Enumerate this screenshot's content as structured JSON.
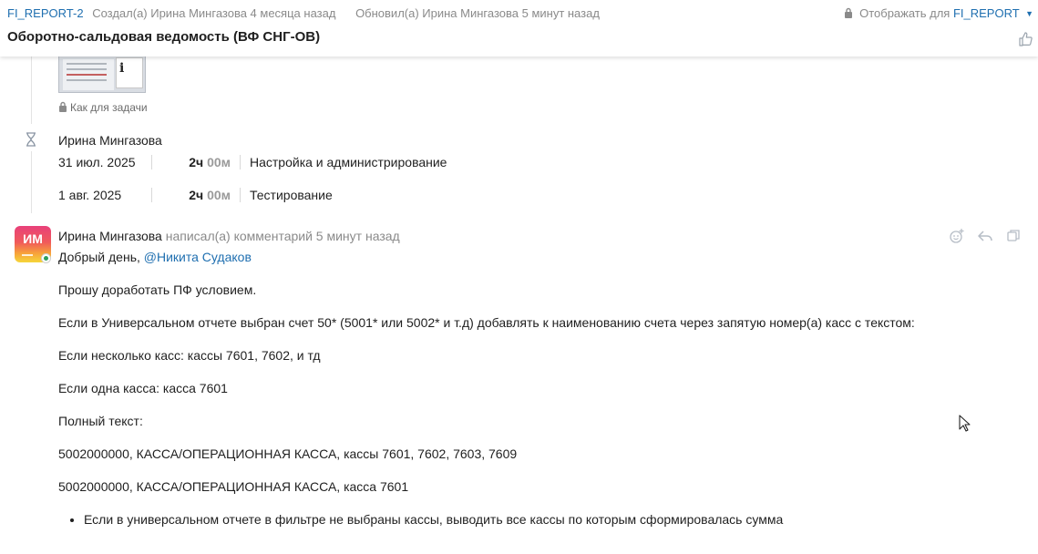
{
  "header": {
    "issue_key": "FI_REPORT-2",
    "created_text": "Создал(а) Ирина Мингазова 4 месяца назад",
    "updated_text": "Обновил(а) Ирина Мингазова 5 минут назад",
    "visibility_label": "Отображать для",
    "visibility_project": "FI_REPORT",
    "title": "Оборотно-сальдовая ведомость (ВФ СНГ-ОВ)"
  },
  "attachment": {
    "visibility_note": "Как для задачи"
  },
  "worklog": {
    "author": "Ирина Мингазова",
    "entries": [
      {
        "date": "31 июл. 2025",
        "hours": "2ч",
        "minutes": "00м",
        "activity": "Настройка и администрирование"
      },
      {
        "date": "1 авг. 2025",
        "hours": "2ч",
        "minutes": "00м",
        "activity": "Тестирование"
      }
    ]
  },
  "comment": {
    "avatar_initials": "ИМ",
    "author": "Ирина Мингазова",
    "action_text": "написал(а) комментарий 5 минут назад",
    "greeting": "Добрый день,",
    "mention": "@Никита Судаков",
    "paragraphs": [
      "Прошу доработать ПФ условием.",
      "Если в Универсальном отчете выбран счет 50* (5001* или 5002* и т.д) добавлять к наименованию счета через запятую номер(а) касс с текстом:",
      "Если несколько касс: кассы 7601, 7602, и тд",
      "Если одна касса: касса 7601",
      "Полный текст:",
      "5002000000, КАССА/ОПЕРАЦИОННАЯ КАССА, кассы 7601, 7602, 7603, 7609",
      "5002000000, КАССА/ОПЕРАЦИОННАЯ КАССА, касса 7601"
    ],
    "bullets": [
      "Если в универсальном отчете в фильтре не выбраны кассы, выводить все кассы по которым сформировалась сумма"
    ]
  },
  "colors": {
    "link": "#1f6fb0",
    "muted": "#8a8a8a",
    "avatar_gradient": [
      "#e8407a",
      "#f7a23a",
      "#f6d63a"
    ]
  },
  "icons": [
    "lock-icon",
    "like-icon",
    "hourglass-icon",
    "emoji-reaction-icon",
    "reply-icon",
    "copy-icon",
    "mouse-cursor-icon"
  ]
}
